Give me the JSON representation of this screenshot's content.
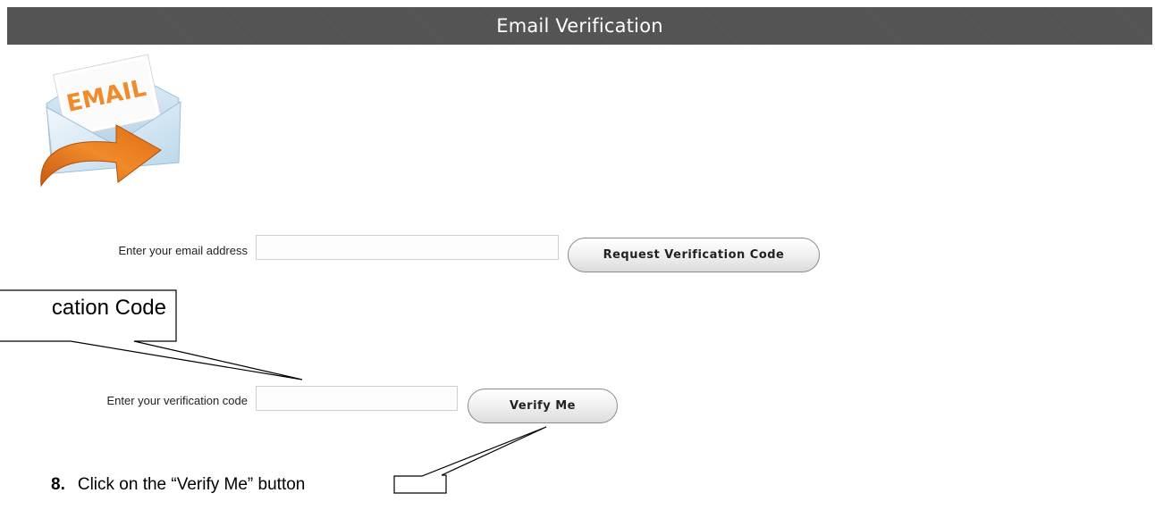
{
  "header": {
    "title": "Email Verification"
  },
  "logo": {
    "text": "EMAIL",
    "icon": "email-envelope-arrow-icon"
  },
  "form": {
    "email_label": "Enter your email address",
    "email_value": "",
    "email_placeholder": "",
    "request_button_label": "Request Verification Code",
    "code_label": "Enter your verification code",
    "code_value": "",
    "code_placeholder": "",
    "verify_button_label": "Verify Me"
  },
  "annotations": {
    "callout_text": "cation Code",
    "instruction_number": "8.",
    "instruction_text": "Click on the “Verify Me” button"
  },
  "colors": {
    "header_bg": "#555555",
    "header_text": "#ffffff",
    "envelope_orange": "#e87a1e",
    "envelope_blue": "#bcd9ec"
  }
}
